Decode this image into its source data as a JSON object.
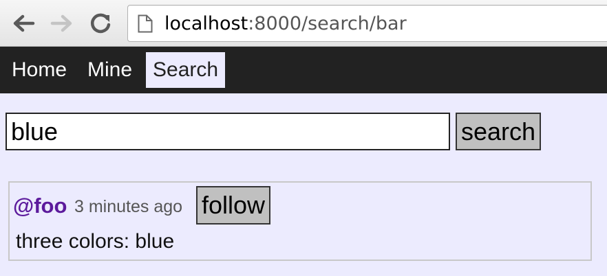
{
  "browser": {
    "url_host": "localhost",
    "url_rest": ":8000/search/bar",
    "back_icon": "back-arrow-icon",
    "forward_icon": "forward-arrow-icon",
    "reload_icon": "reload-icon",
    "page_icon": "document-icon"
  },
  "nav": {
    "items": [
      {
        "label": "Home"
      },
      {
        "label": "Mine"
      },
      {
        "label": "Search",
        "active": true
      }
    ]
  },
  "search": {
    "value": "blue",
    "button_label": "search"
  },
  "results": [
    {
      "handle": "@foo",
      "timestamp": "3 minutes ago",
      "follow_label": "follow",
      "message": "three colors: blue"
    }
  ],
  "colors": {
    "page_bg": "#ecebfe",
    "nav_bg": "#222222",
    "handle": "#5c1a9c",
    "button_bg": "#c0c0c0"
  }
}
